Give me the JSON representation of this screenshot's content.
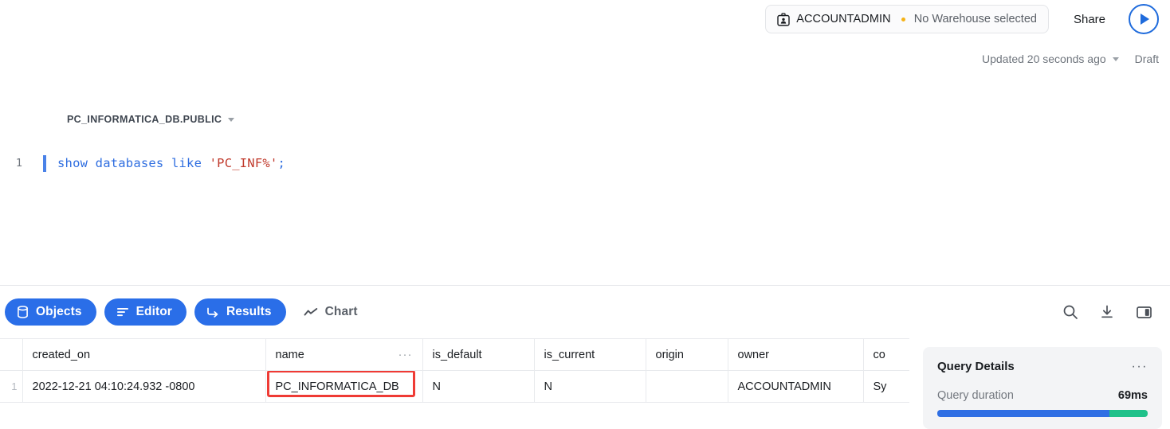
{
  "topbar": {
    "role_icon": "id-badge-icon",
    "role": "ACCOUNTADMIN",
    "warehouse": "No Warehouse selected",
    "warehouse_dot_color": "#f5b216",
    "share_label": "Share",
    "run_icon": "play-icon",
    "run_accent": "#1f6bdc"
  },
  "status": {
    "updated": "Updated 20 seconds ago",
    "caret_icon": "chevron-down-icon",
    "draft": "Draft"
  },
  "context": {
    "database_schema": "PC_INFORMATICA_DB.PUBLIC",
    "caret_icon": "chevron-down-icon"
  },
  "editor": {
    "line_number": "1",
    "code": {
      "kw1": "show databases like ",
      "str": "'PC_INF%'",
      "punct": ";"
    },
    "keyword_color": "#2f6ee0",
    "string_color": "#c0392b"
  },
  "tabs": [
    {
      "label": "Objects",
      "icon": "database-icon",
      "active": true
    },
    {
      "label": "Editor",
      "icon": "lines-icon",
      "active": true
    },
    {
      "label": "Results",
      "icon": "arrow-return-icon",
      "active": true
    },
    {
      "label": "Chart",
      "icon": "line-chart-icon",
      "active": false
    }
  ],
  "tab_accent": "#2a6ee8",
  "toolbar_icons": [
    {
      "name": "search-icon"
    },
    {
      "name": "download-icon"
    },
    {
      "name": "split-panel-icon"
    }
  ],
  "results": {
    "columns": [
      {
        "key": "created_on",
        "label": "created_on",
        "align": "right",
        "menu": false
      },
      {
        "key": "name",
        "label": "name",
        "align": "left",
        "menu": true,
        "menu_label": "···"
      },
      {
        "key": "is_default",
        "label": "is_default",
        "align": "left",
        "menu": false
      },
      {
        "key": "is_current",
        "label": "is_current",
        "align": "left",
        "menu": false
      },
      {
        "key": "origin",
        "label": "origin",
        "align": "left",
        "menu": false
      },
      {
        "key": "owner",
        "label": "owner",
        "align": "right",
        "menu": false
      },
      {
        "key": "comment",
        "label": "co",
        "align": "left",
        "menu": false
      }
    ],
    "rows": [
      {
        "num": "1",
        "created_on": "2022-12-21 04:10:24.932 -0800",
        "name": "PC_INFORMATICA_DB",
        "is_default": "N",
        "is_current": "N",
        "origin": "",
        "owner": "ACCOUNTADMIN",
        "comment": "Sy"
      }
    ],
    "highlight_color": "#ef3b35"
  },
  "query_details": {
    "title": "Query Details",
    "menu_label": "···",
    "duration_label": "Query duration",
    "duration_value": "69ms",
    "bar_blue_pct": 82,
    "bar_green_pct": 18,
    "bar_blue_color": "#2f6fe4",
    "bar_green_color": "#1fc18a"
  }
}
